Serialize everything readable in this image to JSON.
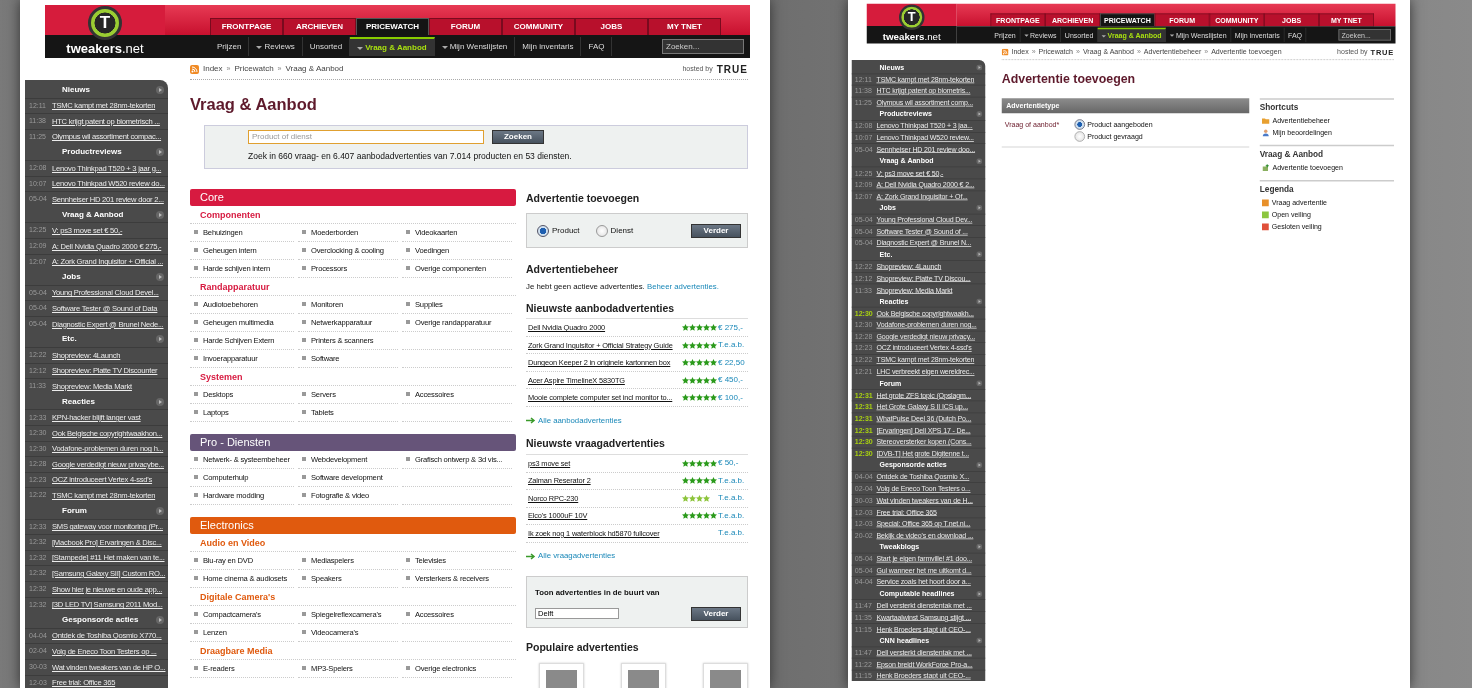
{
  "pages": [
    {
      "kind": "overview",
      "header": {
        "logo": {
          "mark": "T",
          "name": "tweakers",
          "suffix": ".net"
        },
        "tabs": [
          {
            "label": "FRONTPAGE",
            "selected": false
          },
          {
            "label": "ARCHIEVEN",
            "selected": false
          },
          {
            "label": "PRICEWATCH",
            "selected": true
          },
          {
            "label": "FORUM",
            "selected": false
          },
          {
            "label": "COMMUNITY",
            "selected": false
          },
          {
            "label": "JOBS",
            "selected": false
          },
          {
            "label": "MY TNET",
            "selected": false
          }
        ],
        "subnav": [
          {
            "label": "Prijzen",
            "dropdown": false,
            "selected": false
          },
          {
            "label": "Reviews",
            "dropdown": true,
            "selected": false
          },
          {
            "label": "Unsorted",
            "dropdown": false,
            "selected": false
          },
          {
            "label": "Vraag & Aanbod",
            "dropdown": true,
            "selected": true
          },
          {
            "label": "Mijn Wenslijsten",
            "dropdown": true,
            "selected": false
          },
          {
            "label": "Mijn inventaris",
            "dropdown": false,
            "selected": false
          },
          {
            "label": "FAQ",
            "dropdown": false,
            "selected": false
          }
        ],
        "search": {
          "placeholder": "Zoeken..."
        }
      },
      "breadcrumb": {
        "items": [
          "Index",
          "Pricewatch",
          "Vraag & Aanbod"
        ],
        "separator": "»"
      },
      "hosted": {
        "label": "hosted by",
        "brand": "TRUE"
      },
      "sidebar": [
        {
          "title": "Nieuws",
          "items": [
            {
              "time": "12:11",
              "text": "TSMC kampt met 28nm-tekorten"
            },
            {
              "time": "11:38",
              "text": "HTC krijgt patent op biometrisch ..."
            },
            {
              "time": "11:25",
              "text": "Olympus wil assortiment compac..."
            }
          ]
        },
        {
          "title": "Productreviews",
          "items": [
            {
              "time": "12:08",
              "text": "Lenovo Thinkpad T520 + 3 jaar g..."
            },
            {
              "time": "10:07",
              "text": "Lenovo Thinkpad W520 review do..."
            },
            {
              "time": "05-04",
              "text": "Sennheiser HD 201 review door 2..."
            }
          ]
        },
        {
          "title": "Vraag & Aanbod",
          "items": [
            {
              "time": "12:25",
              "text": "V: ps3 move set € 50,-"
            },
            {
              "time": "12:09",
              "text": "A: Dell Nvidia Quadro 2000 € 275,-"
            },
            {
              "time": "12:07",
              "text": "A: Zork Grand Inquisitor + Official ..."
            }
          ]
        },
        {
          "title": "Jobs",
          "items": [
            {
              "time": "05-04",
              "text": "Young Professional Cloud Devel..."
            },
            {
              "time": "05-04",
              "text": "Software Tester @ Sound of Data"
            },
            {
              "time": "05-04",
              "text": "Diagnostic Expert @ Brunel Nede..."
            }
          ]
        },
        {
          "title": "Etc.",
          "items": [
            {
              "time": "12:22",
              "text": "Shopreview: 4Launch"
            },
            {
              "time": "12:12",
              "text": "Shopreview: Platte TV Discounter"
            },
            {
              "time": "11:33",
              "text": "Shopreview: Media Markt"
            }
          ]
        },
        {
          "title": "Reacties",
          "items": [
            {
              "time": "12:33",
              "text": "KPN-hacker blijft langer vast"
            },
            {
              "time": "12:30",
              "text": "Ook Belgische copyrightwaakhon..."
            },
            {
              "time": "12:30",
              "text": "Vodafone-problemen duren nog h..."
            },
            {
              "time": "12:28",
              "text": "Google verdedigt nieuw privacybe..."
            },
            {
              "time": "12:23",
              "text": "OCZ introduceert Vertex 4-ssd's"
            },
            {
              "time": "12:22",
              "text": "TSMC kampt met 28nm-tekorten"
            }
          ]
        },
        {
          "title": "Forum",
          "items": [
            {
              "time": "12:33",
              "text": "SMS gateway voor monitoring (Pr..."
            },
            {
              "time": "12:32",
              "text": "[Macbook Pro] Ervaringen & Disc..."
            },
            {
              "time": "12:32",
              "text": "[Stampede] #11 Het maken van te..."
            },
            {
              "time": "12:32",
              "text": "[Samsung Galaxy SII] Custom RO..."
            },
            {
              "time": "12:32",
              "text": "Show hier je nieuwe en oude app..."
            },
            {
              "time": "12:32",
              "text": "[3D LED TV] Samsung 2011 Mod..."
            }
          ]
        },
        {
          "title": "Gesponsorde acties",
          "items": [
            {
              "time": "04-04",
              "text": "Ontdek de Toshiba Qosmio X770..."
            },
            {
              "time": "02-04",
              "text": "Volg de Eneco Toon Testers op ..."
            },
            {
              "time": "30-03",
              "text": "Wat vinden tweakers van de HP O..."
            },
            {
              "time": "12-03",
              "text": "Free trial: Office 365"
            }
          ]
        }
      ],
      "content": {
        "title": "Vraag & Aanbod",
        "search": {
          "placeholder": "Product of dienst",
          "button": "Zoeken",
          "summary": "Zoek in 660 vraag- en 6.407 aanbodadvertenties van 7.014 producten en 53 diensten."
        },
        "categories": [
          {
            "title": "Core",
            "color": "#d71a40",
            "groups": [
              {
                "title": "Componenten",
                "rows": [
                  [
                    "Behuizingen",
                    "Moederborden",
                    "Videokaarten"
                  ],
                  [
                    "Geheugen intern",
                    "Overclocking & cooling",
                    "Voedingen"
                  ],
                  [
                    "Harde schijven intern",
                    "Processors",
                    "Overige componenten"
                  ]
                ]
              },
              {
                "title": "Randapparatuur",
                "rows": [
                  [
                    "Audiotoebehoren",
                    "Monitoren",
                    "Supplies"
                  ],
                  [
                    "Geheugen multimedia",
                    "Netwerkapparatuur",
                    "Overige randapparatuur"
                  ],
                  [
                    "Harde Schijven Extern",
                    "Printers & scanners"
                  ],
                  [
                    "Invoerapparatuur",
                    "Software"
                  ]
                ]
              },
              {
                "title": "Systemen",
                "rows": [
                  [
                    "Desktops",
                    "Servers",
                    "Accessoires"
                  ],
                  [
                    "Laptops",
                    "Tablets"
                  ]
                ]
              }
            ]
          },
          {
            "title": "Pro - Diensten",
            "color": "#665479",
            "groups": [
              {
                "rows": [
                  [
                    "Netwerk- & systeembeheer",
                    "Webdevelopment",
                    "Grafisch ontwerp & 3d vis..."
                  ],
                  [
                    "Computerhulp",
                    "Software development"
                  ],
                  [
                    "Hardware modding",
                    "Fotografie & video"
                  ]
                ]
              }
            ]
          },
          {
            "title": "Electronics",
            "color": "#e05a0e",
            "groups": [
              {
                "title": "Audio en Video",
                "rows": [
                  [
                    "Blu-ray en DVD",
                    "Mediaspelers",
                    "Televisies"
                  ],
                  [
                    "Home cinema & audiosets",
                    "Speakers",
                    "Versterkers & receivers"
                  ]
                ]
              },
              {
                "title": "Digitale Camera's",
                "rows": [
                  [
                    "Compactcamera's",
                    "Spiegelreflexcamera's",
                    "Accessoires"
                  ],
                  [
                    "Lenzen",
                    "Videocamera's"
                  ]
                ]
              },
              {
                "title": "Draagbare Media",
                "rows": [
                  [
                    "E-readers",
                    "MP3-Spelers",
                    "Overige electronics"
                  ]
                ]
              }
            ]
          }
        ],
        "add_ad": {
          "title": "Advertentie toevoegen",
          "options": [
            {
              "label": "Product",
              "selected": true
            },
            {
              "label": "Dienst",
              "selected": false
            }
          ],
          "button": "Verder"
        },
        "manage": {
          "title": "Advertentiebeheer",
          "text": "Je hebt geen actieve advertenties.",
          "link": "Beheer advertenties."
        },
        "listings": [
          {
            "title": "Nieuwste aanbodadvertenties",
            "rows": [
              {
                "name": "Dell Nvidia Quadro 2000",
                "stars": 5,
                "price": "€ 275,-"
              },
              {
                "name": "Zork Grand Inquisitor + Official Strategy Guide",
                "stars": 5,
                "price": "T.e.a.b."
              },
              {
                "name": "Dungeon Keeper 2 in originele kartonnen box",
                "stars": 5,
                "price": "€ 22,50"
              },
              {
                "name": "Acer Aspire TimelineX 5830TG",
                "stars": 5,
                "price": "€ 450,-"
              },
              {
                "name": "Mooie complete computer set incl monitor to...",
                "stars": 5,
                "price": "€ 100,-"
              }
            ],
            "more": "Alle aanbodadvertenties"
          },
          {
            "title": "Nieuwste vraagadvertenties",
            "rows": [
              {
                "name": "ps3 move set",
                "stars": 5,
                "price": "€ 50,-"
              },
              {
                "name": "Zalman Reserator 2",
                "stars": 5,
                "price": "T.e.a.b."
              },
              {
                "name": "Norco RPC-230",
                "stars": 4,
                "price": "T.e.a.b."
              },
              {
                "name": "Elco's 1000uF 10V",
                "stars": 5,
                "price": "T.e.a.b."
              },
              {
                "name": "Ik zoek nog 1 waterblock hd5870 fullcover",
                "price": "T.e.a.b."
              }
            ],
            "more": "Alle vraagadvertenties"
          }
        ],
        "nearby": {
          "label": "Toon advertenties in de buurt van",
          "value": "Delft",
          "button": "Verder"
        },
        "popular": {
          "title": "Populaire advertenties",
          "items": [
            {
              "kind": "photo"
            },
            {
              "kind": "photo"
            },
            {
              "kind": "photo"
            }
          ]
        }
      }
    },
    {
      "kind": "form",
      "header": {
        "logo": {
          "mark": "T",
          "name": "tweakers",
          "suffix": ".net"
        },
        "tabs": [
          {
            "label": "FRONTPAGE",
            "selected": false
          },
          {
            "label": "ARCHIEVEN",
            "selected": false
          },
          {
            "label": "PRICEWATCH",
            "selected": true
          },
          {
            "label": "FORUM",
            "selected": false
          },
          {
            "label": "COMMUNITY",
            "selected": false
          },
          {
            "label": "JOBS",
            "selected": false
          },
          {
            "label": "MY TNET",
            "selected": false
          }
        ],
        "subnav": [
          {
            "label": "Prijzen",
            "dropdown": false,
            "selected": false
          },
          {
            "label": "Reviews",
            "dropdown": true,
            "selected": false
          },
          {
            "label": "Unsorted",
            "dropdown": false,
            "selected": false
          },
          {
            "label": "Vraag & Aanbod",
            "dropdown": true,
            "selected": true
          },
          {
            "label": "Mijn Wenslijsten",
            "dropdown": true,
            "selected": false
          },
          {
            "label": "Mijn inventaris",
            "dropdown": false,
            "selected": false
          },
          {
            "label": "FAQ",
            "dropdown": false,
            "selected": false
          }
        ],
        "search": {
          "placeholder": "Zoeken..."
        }
      },
      "breadcrumb": {
        "items": [
          "Index",
          "Pricewatch",
          "Vraag & Aanbod",
          "Advertentiebeheer",
          "Advertentie toevoegen"
        ],
        "separator": "»"
      },
      "hosted": {
        "label": "hosted by",
        "brand": "TRUE"
      },
      "sidebar": [
        {
          "title": "Nieuws",
          "items": [
            {
              "time": "12:11",
              "text": "TSMC kampt met 28nm-tekorten",
              "new": false
            },
            {
              "time": "11:38",
              "text": "HTC krijgt patent op biometris...",
              "new": false
            },
            {
              "time": "11:25",
              "text": "Olympus wil assortiment comp...",
              "new": false
            }
          ]
        },
        {
          "title": "Productreviews",
          "items": [
            {
              "time": "12:08",
              "text": "Lenovo Thinkpad T520 + 3 jaa...",
              "new": false
            },
            {
              "time": "10:07",
              "text": "Lenovo Thinkpad W520 review...",
              "new": false
            },
            {
              "time": "05-04",
              "text": "Sennheiser HD 201 review doo...",
              "new": false
            }
          ]
        },
        {
          "title": "Vraag & Aanbod",
          "items": [
            {
              "time": "12:25",
              "text": "V: ps3 move set € 50,-",
              "new": false
            },
            {
              "time": "12:09",
              "text": "A: Dell Nvidia Quadro 2000 € 2...",
              "new": false
            },
            {
              "time": "12:07",
              "text": "A: Zork Grand Inquisitor + Of...",
              "new": false
            }
          ]
        },
        {
          "title": "Jobs",
          "items": [
            {
              "time": "05-04",
              "text": "Young Professional Cloud Dev...",
              "new": false
            },
            {
              "time": "05-04",
              "text": "Software Tester @ Sound of ...",
              "new": false
            },
            {
              "time": "05-04",
              "text": "Diagnostic Expert @ Brunel N...",
              "new": false
            }
          ]
        },
        {
          "title": "Etc.",
          "items": [
            {
              "time": "12:22",
              "text": "Shopreview: 4Launch",
              "new": false
            },
            {
              "time": "12:12",
              "text": "Shopreview: Platte TV Discou...",
              "new": false
            },
            {
              "time": "11:33",
              "text": "Shopreview: Media Markt",
              "new": false
            }
          ]
        },
        {
          "title": "Reacties",
          "items": [
            {
              "time": "12:30",
              "text": "Ook Belgische copyrightwaakh...",
              "new": true
            },
            {
              "time": "12:30",
              "text": "Vodafone-problemen duren nog...",
              "new": false
            },
            {
              "time": "12:28",
              "text": "Google verdedigt nieuw privacy...",
              "new": false
            },
            {
              "time": "12:23",
              "text": "OCZ introduceert Vertex 4-ssd's",
              "new": false
            },
            {
              "time": "12:22",
              "text": "TSMC kampt met 28nm-tekorten",
              "new": false
            },
            {
              "time": "12:21",
              "text": "LHC verbreekt eigen wereldrec...",
              "new": false
            }
          ]
        },
        {
          "title": "Forum",
          "items": [
            {
              "time": "12:31",
              "text": "Het grote ZFS topic (Opslagm...",
              "new": true
            },
            {
              "time": "12:31",
              "text": "Het Grote Galaxy S II ICS up...",
              "new": true
            },
            {
              "time": "12:31",
              "text": "WhatPulse Deel 36 (Dutch Po...",
              "new": true
            },
            {
              "time": "12:31",
              "text": "[Ervaringen] Dell XPS 17 - De...",
              "new": true
            },
            {
              "time": "12:30",
              "text": "Stereoversterker kopen (Cons...",
              "new": true
            },
            {
              "time": "12:30",
              "text": "[DVB-T] Het grote Digitenne t...",
              "new": true
            }
          ]
        },
        {
          "title": "Gesponsorde acties",
          "items": [
            {
              "time": "04-04",
              "text": "Ontdek de Toshiba Qosmio X...",
              "new": false
            },
            {
              "time": "02-04",
              "text": "Volg de Eneco Toon Testers o...",
              "new": false
            },
            {
              "time": "30-03",
              "text": "Wat vinden tweakers van de H...",
              "new": false
            },
            {
              "time": "12-03",
              "text": "Free trial: Office 365",
              "new": false
            },
            {
              "time": "12-03",
              "text": "Special: Office 365 op T.net.ni...",
              "new": false
            },
            {
              "time": "20-02",
              "text": "Bekijk de video's en download ...",
              "new": false
            }
          ]
        },
        {
          "title": "Tweakblogs",
          "items": [
            {
              "time": "05-04",
              "text": "Start je eigen farmville! #1 doo...",
              "new": false
            },
            {
              "time": "05-04",
              "text": "Gul wanneer het me uitkomt d...",
              "new": false
            },
            {
              "time": "04-04",
              "text": "Service zoals het hoort door a...",
              "new": false
            }
          ]
        },
        {
          "title": "Computable headlines",
          "items": [
            {
              "time": "11:47",
              "text": "Dell versterkt dienstentak met ...",
              "new": false
            },
            {
              "time": "11:35",
              "text": "Kwartaalwinst Samsung stijgt ...",
              "new": false
            },
            {
              "time": "11:15",
              "text": "Henk Broeders stapt uit CEO-...",
              "new": false
            }
          ]
        },
        {
          "title": "CNN headlines",
          "items": [
            {
              "time": "11:47",
              "text": "Dell versterkt dienstentak met ...",
              "new": false
            },
            {
              "time": "11:22",
              "text": "Epson breidt WorkForce Pro-a...",
              "new": false
            },
            {
              "time": "11:15",
              "text": "Henk Broeders stapt uit CEO-...",
              "new": false
            }
          ]
        }
      ],
      "content": {
        "title": "Advertentie toevoegen",
        "section": {
          "title": "Advertentietype",
          "label": "Vraag of aanbod*",
          "options": [
            {
              "label": "Product aangeboden",
              "selected": true
            },
            {
              "label": "Product gevraagd",
              "selected": false
            }
          ]
        },
        "aside": [
          {
            "title": "Shortcuts",
            "items": [
              {
                "label": "Advertentiebeheer"
              },
              {
                "label": "Mijn beoordelingen"
              }
            ]
          },
          {
            "title": "Vraag & Aanbod",
            "items": [
              {
                "label": "Advertentie toevoegen"
              }
            ]
          },
          {
            "title": "Legenda",
            "items": [
              {
                "label": "Vraag advertentie",
                "color": "#e8902a"
              },
              {
                "label": "Open veiling",
                "color": "#8cc63f"
              },
              {
                "label": "Gesloten veiling",
                "color": "#e0503a"
              }
            ]
          }
        ]
      }
    }
  ]
}
